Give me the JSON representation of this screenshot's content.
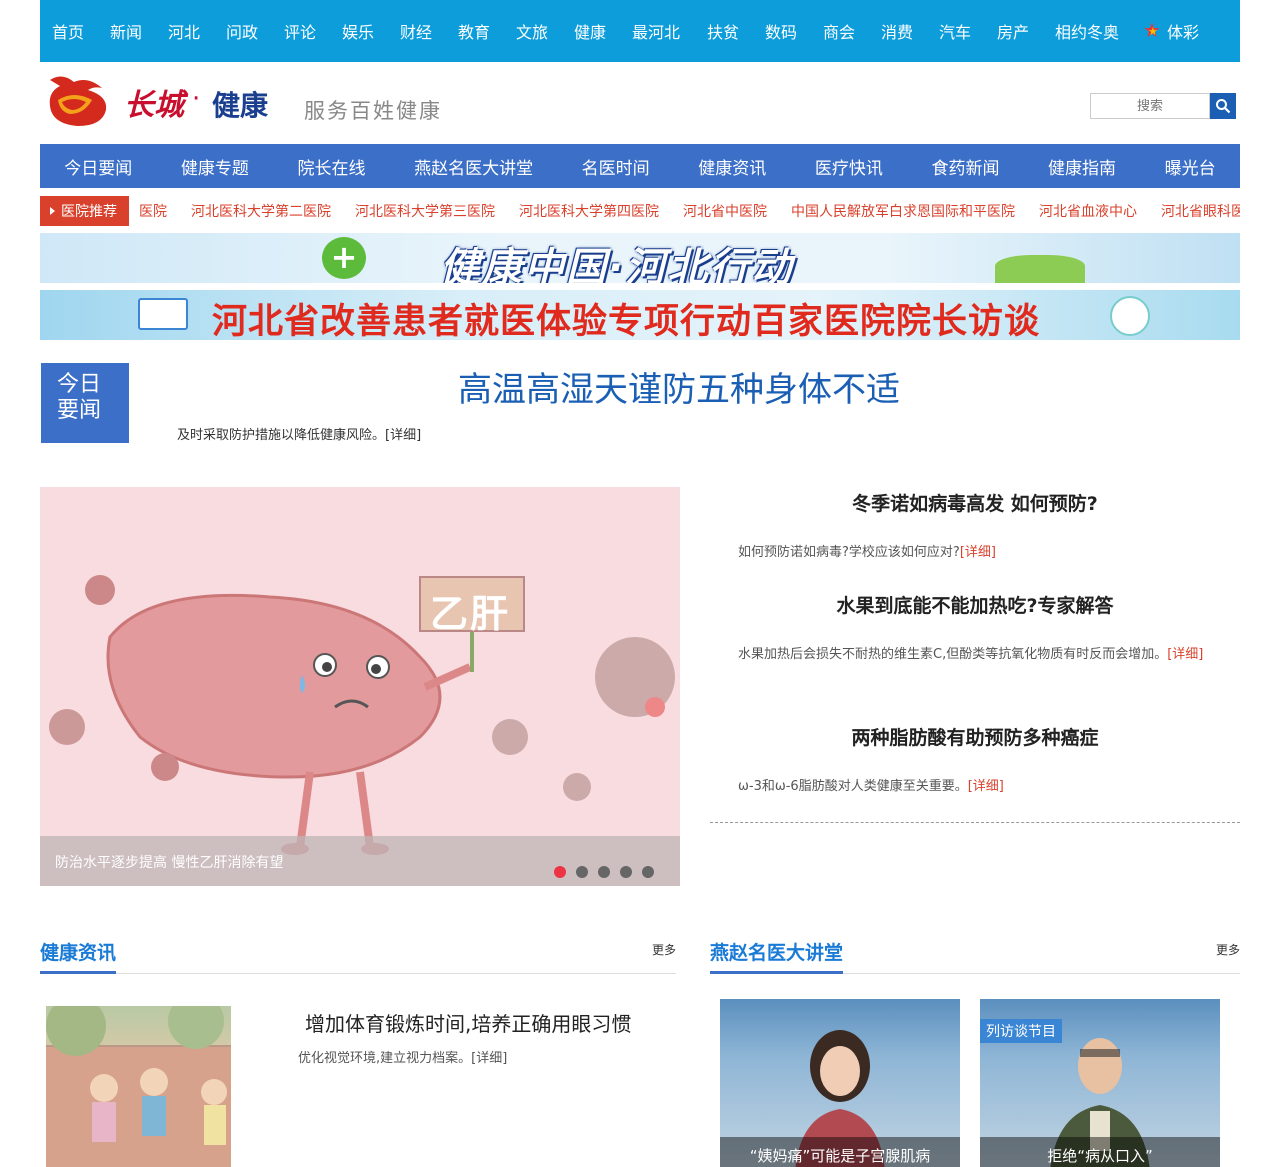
{
  "top_nav": [
    "首页",
    "新闻",
    "河北",
    "问政",
    "评论",
    "娱乐",
    "财经",
    "教育",
    "文旅",
    "健康",
    "最河北",
    "扶贫",
    "数码",
    "商会",
    "消费",
    "汽车",
    "房产",
    "相约冬奥",
    "体彩"
  ],
  "header": {
    "logo_text": "长城",
    "logo_dot": "·",
    "logo_sub": "健康",
    "slogan": "服务百姓健康",
    "search_placeholder": "搜索"
  },
  "main_nav": [
    "今日要闻",
    "健康专题",
    "院长在线",
    "燕赵名医大讲堂",
    "名医时间",
    "健康资讯",
    "医疗快讯",
    "食药新闻",
    "健康指南",
    "曝光台"
  ],
  "hospitals": {
    "label": "医院推荐",
    "items": [
      "医院",
      "河北医科大学第二医院",
      "河北医科大学第三医院",
      "河北医科大学第四医院",
      "河北省中医院",
      "中国人民解放军白求恩国际和平医院",
      "河北省血液中心",
      "河北省眼科医院"
    ]
  },
  "banners": {
    "banner1": "健康中国·河北行动",
    "banner2": "河北省改善患者就医体验专项行动百家医院院长访谈"
  },
  "today": {
    "badge_line1": "今日",
    "badge_line2": "要闻",
    "title": "高温高湿天谨防五种身体不适",
    "desc": "及时采取防护措施以降低健康风险。[详细]"
  },
  "slider": {
    "caption": "防治水平逐步提高 慢性乙肝消除有望",
    "sign_text": "乙肝",
    "dots": 5,
    "active_dot": 1
  },
  "news": [
    {
      "title": "冬季诺如病毒高发 如何预防?",
      "desc": "如何预防诺如病毒?学校应该如何应对?",
      "more": "[详细]"
    },
    {
      "title": "水果到底能不能加热吃?专家解答",
      "desc": "水果加热后会损失不耐热的维生素C,但酚类等抗氧化物质有时反而会增加。",
      "more": "[详细]"
    },
    {
      "title": "两种脂肪酸有助预防多种癌症",
      "desc": "ω-3和ω-6脂肪酸对人类健康至关重要。",
      "more": "[详细]"
    }
  ],
  "section_left": {
    "title": "健康资讯",
    "more": "更多",
    "article_title": "增加体育锻炼时间,培养正确用眼习惯",
    "article_desc": "优化视觉环境,建立视力档案。[详细]"
  },
  "section_right": {
    "title": "燕赵名医大讲堂",
    "more": "更多",
    "videos": [
      {
        "caption": "“姨妈痛”可能是子宫腺肌病"
      },
      {
        "caption": "拒绝“病从口入”",
        "bg_text": "列访谈节目"
      }
    ]
  },
  "colors": {
    "top_nav_bg": "#0d9ddb",
    "main_nav_bg": "#3c6fc7",
    "accent_red": "#d9412c",
    "headline_blue": "#1a5fb4"
  }
}
